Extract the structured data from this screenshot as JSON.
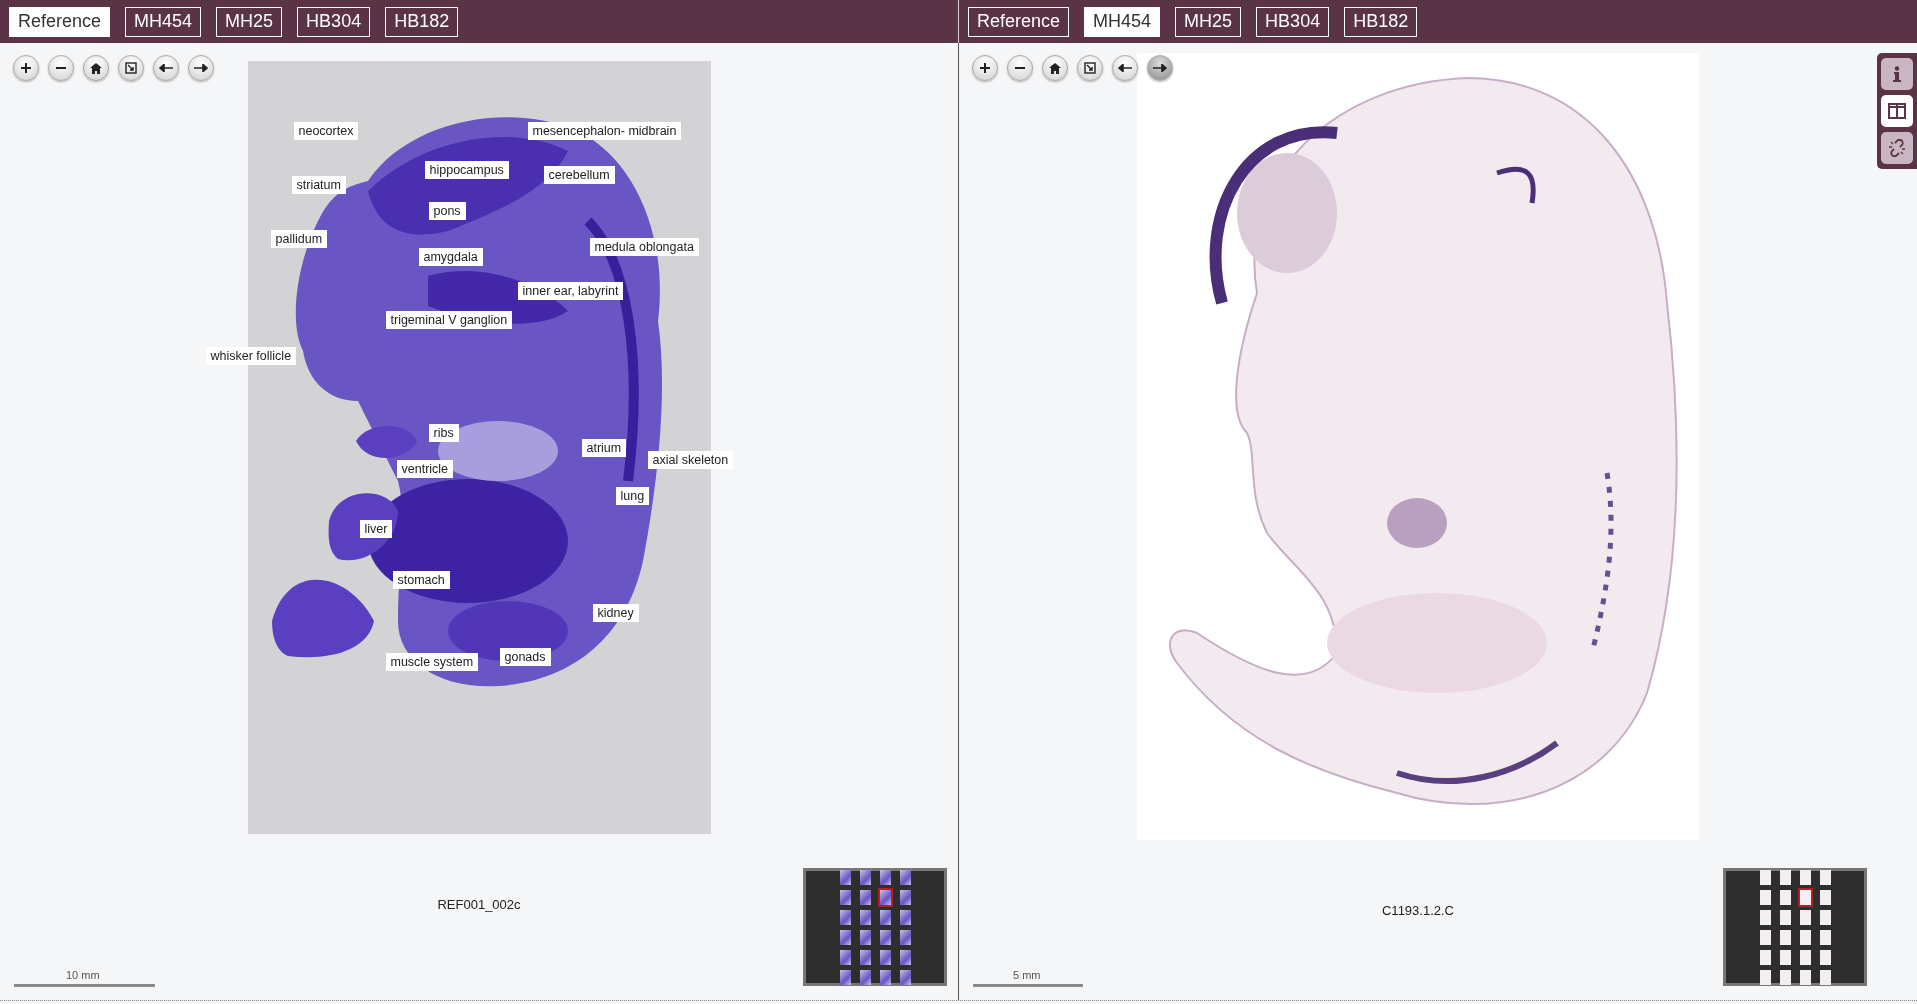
{
  "panes": [
    {
      "tabs": [
        {
          "label": "Reference",
          "selected": true
        },
        {
          "label": "MH454",
          "selected": false
        },
        {
          "label": "MH25",
          "selected": false
        },
        {
          "label": "HB304",
          "selected": false
        },
        {
          "label": "HB182",
          "selected": false
        }
      ],
      "toolbar": [
        {
          "kind": "zoom-in",
          "active": false
        },
        {
          "kind": "zoom-out",
          "active": false
        },
        {
          "kind": "home",
          "active": false
        },
        {
          "kind": "fit",
          "active": false
        },
        {
          "kind": "previous",
          "active": false
        },
        {
          "kind": "next",
          "active": false
        }
      ],
      "specimen": {
        "kind": "stained",
        "labels": [
          "neocortex",
          "mesencephalon- midbrain",
          "hippocampus",
          "cerebellum",
          "striatum",
          "pons",
          "pallidum",
          "amygdala",
          "medula oblongata",
          "inner ear, labyrint",
          "trigeminal V ganglion",
          "whisker follicle",
          "ribs",
          "atrium",
          "axial skeleton",
          "ventricle",
          "lung",
          "liver",
          "stomach",
          "kidney",
          "gonads",
          "muscle system"
        ]
      },
      "caption": "REF001_002c",
      "minimap": {
        "kind": "stained",
        "thumbnails": [
          {
            "selected": false
          },
          {
            "selected": false
          },
          {
            "selected": false
          },
          {
            "selected": false
          },
          {
            "selected": false
          },
          {
            "selected": false
          },
          {
            "selected": true
          },
          {
            "selected": false
          },
          {
            "selected": false
          },
          {
            "selected": false
          },
          {
            "selected": false
          },
          {
            "selected": false
          },
          {
            "selected": false
          },
          {
            "selected": false
          },
          {
            "selected": false
          },
          {
            "selected": false
          },
          {
            "selected": false
          },
          {
            "selected": false
          },
          {
            "selected": false
          },
          {
            "selected": false
          },
          {
            "selected": false
          },
          {
            "selected": false
          },
          {
            "selected": false
          },
          {
            "selected": false
          }
        ]
      },
      "scale_bar": {
        "label": "10 mm"
      }
    },
    {
      "tabs": [
        {
          "label": "Reference",
          "selected": false
        },
        {
          "label": "MH454",
          "selected": true
        },
        {
          "label": "MH25",
          "selected": false
        },
        {
          "label": "HB304",
          "selected": false
        },
        {
          "label": "HB182",
          "selected": false
        }
      ],
      "toolbar": [
        {
          "kind": "zoom-in",
          "active": false
        },
        {
          "kind": "zoom-out",
          "active": false
        },
        {
          "kind": "home",
          "active": false
        },
        {
          "kind": "fit",
          "active": false
        },
        {
          "kind": "previous",
          "active": false
        },
        {
          "kind": "next",
          "active": true
        }
      ],
      "specimen": {
        "kind": "in-situ"
      },
      "caption": "C1193.1.2.C",
      "minimap": {
        "kind": "in-situ",
        "thumbnails": [
          {
            "selected": false
          },
          {
            "selected": false
          },
          {
            "selected": false
          },
          {
            "selected": false
          },
          {
            "selected": false
          },
          {
            "selected": false
          },
          {
            "selected": true
          },
          {
            "selected": false
          },
          {
            "selected": false
          },
          {
            "selected": false
          },
          {
            "selected": false
          },
          {
            "selected": false
          },
          {
            "selected": false
          },
          {
            "selected": false
          },
          {
            "selected": false
          },
          {
            "selected": false
          },
          {
            "selected": false
          },
          {
            "selected": false
          },
          {
            "selected": false
          },
          {
            "selected": false
          },
          {
            "selected": false
          },
          {
            "selected": false
          },
          {
            "selected": false
          },
          {
            "selected": false
          }
        ]
      },
      "scale_bar": {
        "label": "5 mm"
      }
    }
  ],
  "side_buttons": [
    {
      "kind": "info",
      "selected": false
    },
    {
      "kind": "split-view",
      "selected": true
    },
    {
      "kind": "unlink",
      "selected": false
    }
  ]
}
